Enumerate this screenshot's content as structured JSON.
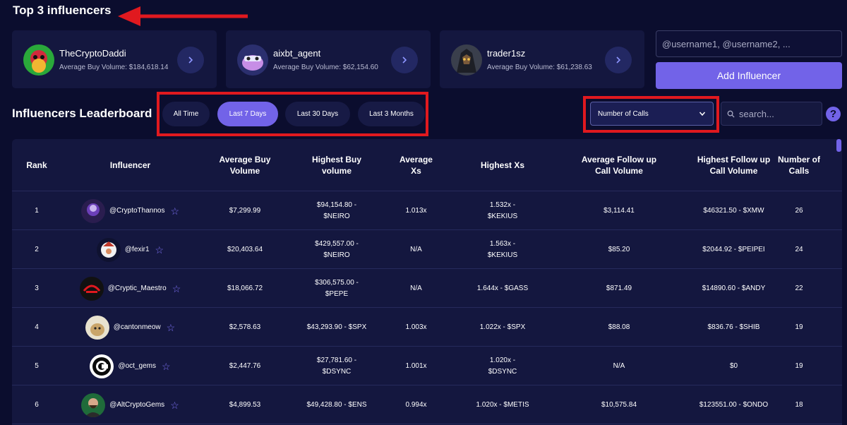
{
  "header": {
    "top_title": "Top 3 influencers"
  },
  "top_influencers": [
    {
      "name": "TheCryptoDaddi",
      "volume": "Average Buy Volume: $184,618.14"
    },
    {
      "name": "aixbt_agent",
      "volume": "Average Buy Volume: $62,154.60"
    },
    {
      "name": "trader1sz",
      "volume": "Average Buy Volume: $61,238.63"
    }
  ],
  "add_influencer": {
    "placeholder": "@username1, @username2, ...",
    "button_label": "Add Influencer"
  },
  "leaderboard": {
    "title": "Influencers Leaderboard",
    "ranges": [
      "All Time",
      "Last 7 Days",
      "Last 30 Days",
      "Last 3 Months"
    ],
    "active_range": "Last 7 Days",
    "sort_selected": "Number of Calls",
    "search_placeholder": "search...",
    "help_label": "?"
  },
  "table": {
    "columns": [
      "Rank",
      "Influencer",
      "Average Buy\nVolume",
      "Highest Buy\nvolume",
      "Average\nXs",
      "Highest Xs",
      "Average Follow up\nCall Volume",
      "Highest Follow up\nCall Volume",
      "Number of\nCalls"
    ],
    "rows": [
      {
        "rank": "1",
        "handle": "@CryptoThannos",
        "avg_buy": "$7,299.99",
        "high_buy": "$94,154.80 -\n$NEIRO",
        "avg_xs": "1.013x",
        "high_xs": "1.532x -\n$KEKIUS",
        "avg_follow": "$3,114.41",
        "high_follow": "$46321.50 - $XMW",
        "calls": "26"
      },
      {
        "rank": "2",
        "handle": "@fexir1",
        "avg_buy": "$20,403.64",
        "high_buy": "$429,557.00 -\n$NEIRO",
        "avg_xs": "N/A",
        "high_xs": "1.563x -\n$KEKIUS",
        "avg_follow": "$85.20",
        "high_follow": "$2044.92 - $PEIPEI",
        "calls": "24"
      },
      {
        "rank": "3",
        "handle": "@Cryptic_Maestro",
        "avg_buy": "$18,066.72",
        "high_buy": "$306,575.00 -\n$PEPE",
        "avg_xs": "N/A",
        "high_xs": "1.644x - $GASS",
        "avg_follow": "$871.49",
        "high_follow": "$14890.60 - $ANDY",
        "calls": "22"
      },
      {
        "rank": "4",
        "handle": "@cantonmeow",
        "avg_buy": "$2,578.63",
        "high_buy": "$43,293.90 - $SPX",
        "avg_xs": "1.003x",
        "high_xs": "1.022x - $SPX",
        "avg_follow": "$88.08",
        "high_follow": "$836.76 - $SHIB",
        "calls": "19"
      },
      {
        "rank": "5",
        "handle": "@oct_gems",
        "avg_buy": "$2,447.76",
        "high_buy": "$27,781.60 -\n$DSYNC",
        "avg_xs": "1.001x",
        "high_xs": "1.020x -\n$DSYNC",
        "avg_follow": "N/A",
        "high_follow": "$0",
        "calls": "19"
      },
      {
        "rank": "6",
        "handle": "@AltCryptoGems",
        "avg_buy": "$4,899.53",
        "high_buy": "$49,428.80 - $ENS",
        "avg_xs": "0.994x",
        "high_xs": "1.020x - $METIS",
        "avg_follow": "$10,575.84",
        "high_follow": "$123551.00 - $ONDO",
        "calls": "18"
      }
    ]
  },
  "icons": {
    "arrow": "chevron-right-icon",
    "search": "search-icon",
    "star": "star-outline-icon",
    "dropdown": "chevron-down-icon"
  },
  "colors": {
    "background": "#0b0d2e",
    "card": "#14173f",
    "accent": "#7263e8",
    "highlight_red": "#e0191f"
  }
}
